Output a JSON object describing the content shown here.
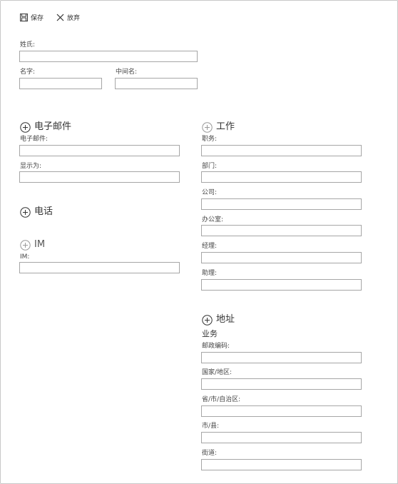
{
  "toolbar": {
    "save_label": "保存",
    "discard_label": "放弃"
  },
  "name": {
    "last_name_label": "姓氏:",
    "first_name_label": "名字:",
    "middle_name_label": "中间名:"
  },
  "email_section": {
    "title": "电子邮件",
    "email_label": "电子邮件:",
    "display_as_label": "显示为:"
  },
  "phone_section": {
    "title": "电话"
  },
  "im_section": {
    "title": "IM",
    "im_label": "IM:"
  },
  "work_section": {
    "title": "工作",
    "job_title_label": "职务:",
    "department_label": "部门:",
    "company_label": "公司:",
    "office_label": "办公室:",
    "manager_label": "经理:",
    "assistant_label": "助理:"
  },
  "address_section": {
    "title": "地址",
    "subtitle": "业务",
    "postal_code_label": "邮政编码:",
    "country_label": "国家/地区:",
    "state_label": "省/市/自治区:",
    "city_label": "市/县:",
    "street_label": "街道:"
  },
  "colors": {
    "border": "#a6a6a6",
    "text": "#333333",
    "frame": "#c8c8c8"
  }
}
